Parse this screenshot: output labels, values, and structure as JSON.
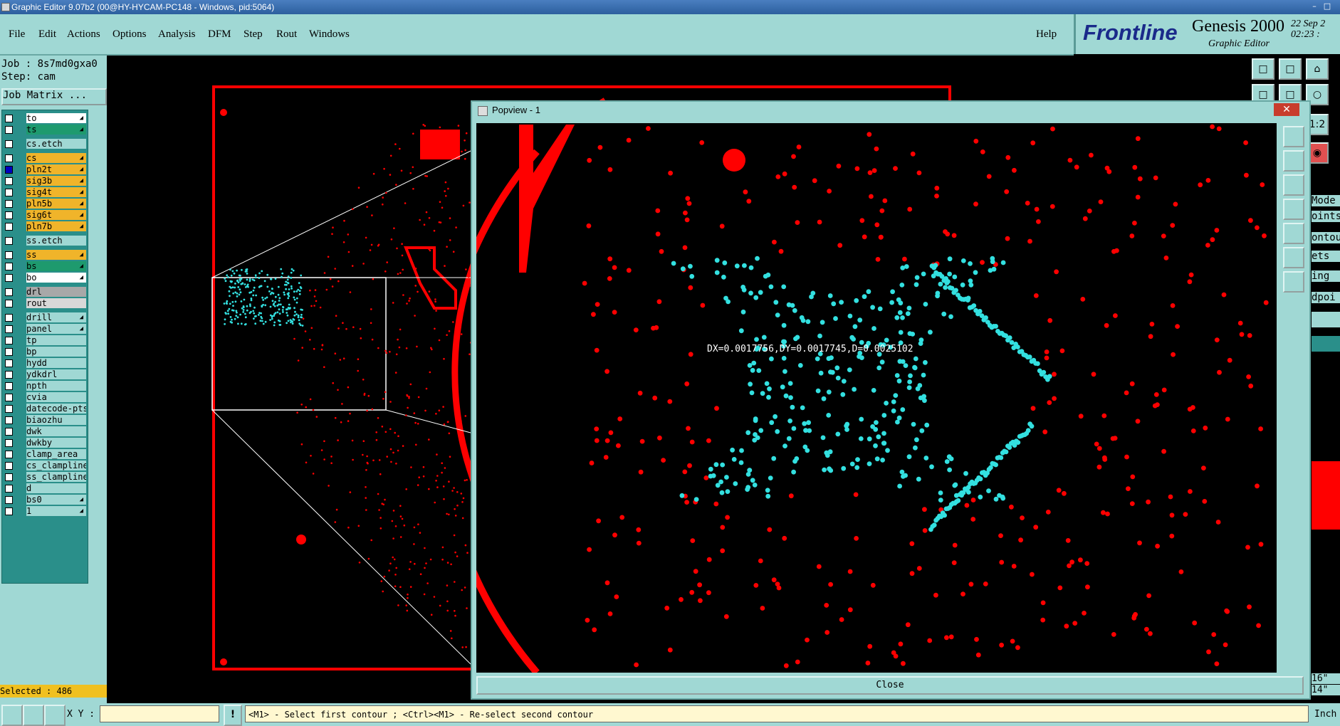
{
  "window": {
    "title": "Graphic Editor 9.07b2 (00@HY-HYCAM-PC148 - Windows, pid:5064)"
  },
  "menu": {
    "items": [
      "File",
      "Edit",
      "Actions",
      "Options",
      "Analysis",
      "DFM",
      "Step",
      "Rout",
      "Windows"
    ],
    "help": "Help"
  },
  "brand": {
    "logo": "Frontline",
    "product": "Genesis 2000",
    "subtitle": "Graphic Editor",
    "date": "22 Sep 2",
    "time": "02:23 :"
  },
  "job": {
    "job_line": "Job : 8s7md0gxa0",
    "step_line": "Step: cam",
    "matrix_button": "Job Matrix ..."
  },
  "layers": [
    {
      "name": "to",
      "color": "#ffffff",
      "checked": false,
      "mark": "◢"
    },
    {
      "name": "ts",
      "color": "#1e9a6e",
      "checked": false,
      "mark": "◢"
    },
    {
      "name": "cs.etch",
      "color": "#a0d8d4",
      "checked": false,
      "mark": ""
    },
    {
      "name": "cs",
      "color": "#f0b42a",
      "checked": false,
      "mark": "◢"
    },
    {
      "name": "pln2t",
      "color": "#f0b42a",
      "checked": true,
      "mark": "◢"
    },
    {
      "name": "sig3b",
      "color": "#f0b42a",
      "checked": false,
      "mark": "◢"
    },
    {
      "name": "sig4t",
      "color": "#f0b42a",
      "checked": false,
      "mark": "◢"
    },
    {
      "name": "pln5b",
      "color": "#f0b42a",
      "checked": false,
      "mark": "◢"
    },
    {
      "name": "sig6t",
      "color": "#f0b42a",
      "checked": false,
      "mark": "◢"
    },
    {
      "name": "pln7b",
      "color": "#f0b42a",
      "checked": false,
      "mark": "◢"
    },
    {
      "name": "ss.etch",
      "color": "#a0d8d4",
      "checked": false,
      "mark": ""
    },
    {
      "name": "ss",
      "color": "#f0b42a",
      "checked": false,
      "mark": "◢"
    },
    {
      "name": "bs",
      "color": "#1e9a6e",
      "checked": false,
      "mark": "◢"
    },
    {
      "name": "bo",
      "color": "#ffffff",
      "checked": false,
      "mark": "◢"
    },
    {
      "name": "drl",
      "color": "#a8a8a8",
      "checked": false,
      "mark": ""
    },
    {
      "name": "rout",
      "color": "#d8d8d8",
      "checked": false,
      "mark": ""
    },
    {
      "name": "drill",
      "color": "#a0d8d4",
      "checked": false,
      "mark": "◢"
    },
    {
      "name": "panel",
      "color": "#a0d8d4",
      "checked": false,
      "mark": "◢"
    },
    {
      "name": "tp",
      "color": "#a0d8d4",
      "checked": false,
      "mark": ""
    },
    {
      "name": "bp",
      "color": "#a0d8d4",
      "checked": false,
      "mark": ""
    },
    {
      "name": "hydd",
      "color": "#a0d8d4",
      "checked": false,
      "mark": ""
    },
    {
      "name": "ydkdrl",
      "color": "#a0d8d4",
      "checked": false,
      "mark": ""
    },
    {
      "name": "npth",
      "color": "#a0d8d4",
      "checked": false,
      "mark": ""
    },
    {
      "name": "cvia",
      "color": "#a0d8d4",
      "checked": false,
      "mark": ""
    },
    {
      "name": "datecode-pts",
      "color": "#a0d8d4",
      "checked": false,
      "mark": ""
    },
    {
      "name": "biaozhu",
      "color": "#a0d8d4",
      "checked": false,
      "mark": ""
    },
    {
      "name": "dwk",
      "color": "#a0d8d4",
      "checked": false,
      "mark": ""
    },
    {
      "name": "dwkby",
      "color": "#a0d8d4",
      "checked": false,
      "mark": ""
    },
    {
      "name": "clamp_area",
      "color": "#a0d8d4",
      "checked": false,
      "mark": ""
    },
    {
      "name": "cs_clampline",
      "color": "#a0d8d4",
      "checked": false,
      "mark": ""
    },
    {
      "name": "ss_clampline",
      "color": "#a0d8d4",
      "checked": false,
      "mark": ""
    },
    {
      "name": "d",
      "color": "#a0d8d4",
      "checked": false,
      "mark": ""
    },
    {
      "name": "bs0",
      "color": "#a0d8d4",
      "checked": false,
      "mark": "◢"
    },
    {
      "name": "1",
      "color": "#a0d8d4",
      "checked": false,
      "mark": "◢"
    }
  ],
  "selected": "Selected : 486",
  "statusbar": {
    "xy_label": "X Y :",
    "xy_value": "",
    "message": "<M1> - Select first contour ; <Ctrl><M1> - Re-select second contour"
  },
  "popview": {
    "title": "Popview - 1",
    "close_label": "Close",
    "measure": "DX=0.0017756,DY=0.0017745,D=0.0025102"
  },
  "right_panel": {
    "labels": [
      "Mode",
      "oints",
      "ontou",
      "ets",
      "ing",
      "dpoi"
    ],
    "coord1": "16\"",
    "coord2": "14\"",
    "units": "Inch"
  },
  "colors": {
    "panel": "#a0d8d4",
    "copper": "#ff0000",
    "selected": "#33e0e0",
    "background": "#000000"
  }
}
